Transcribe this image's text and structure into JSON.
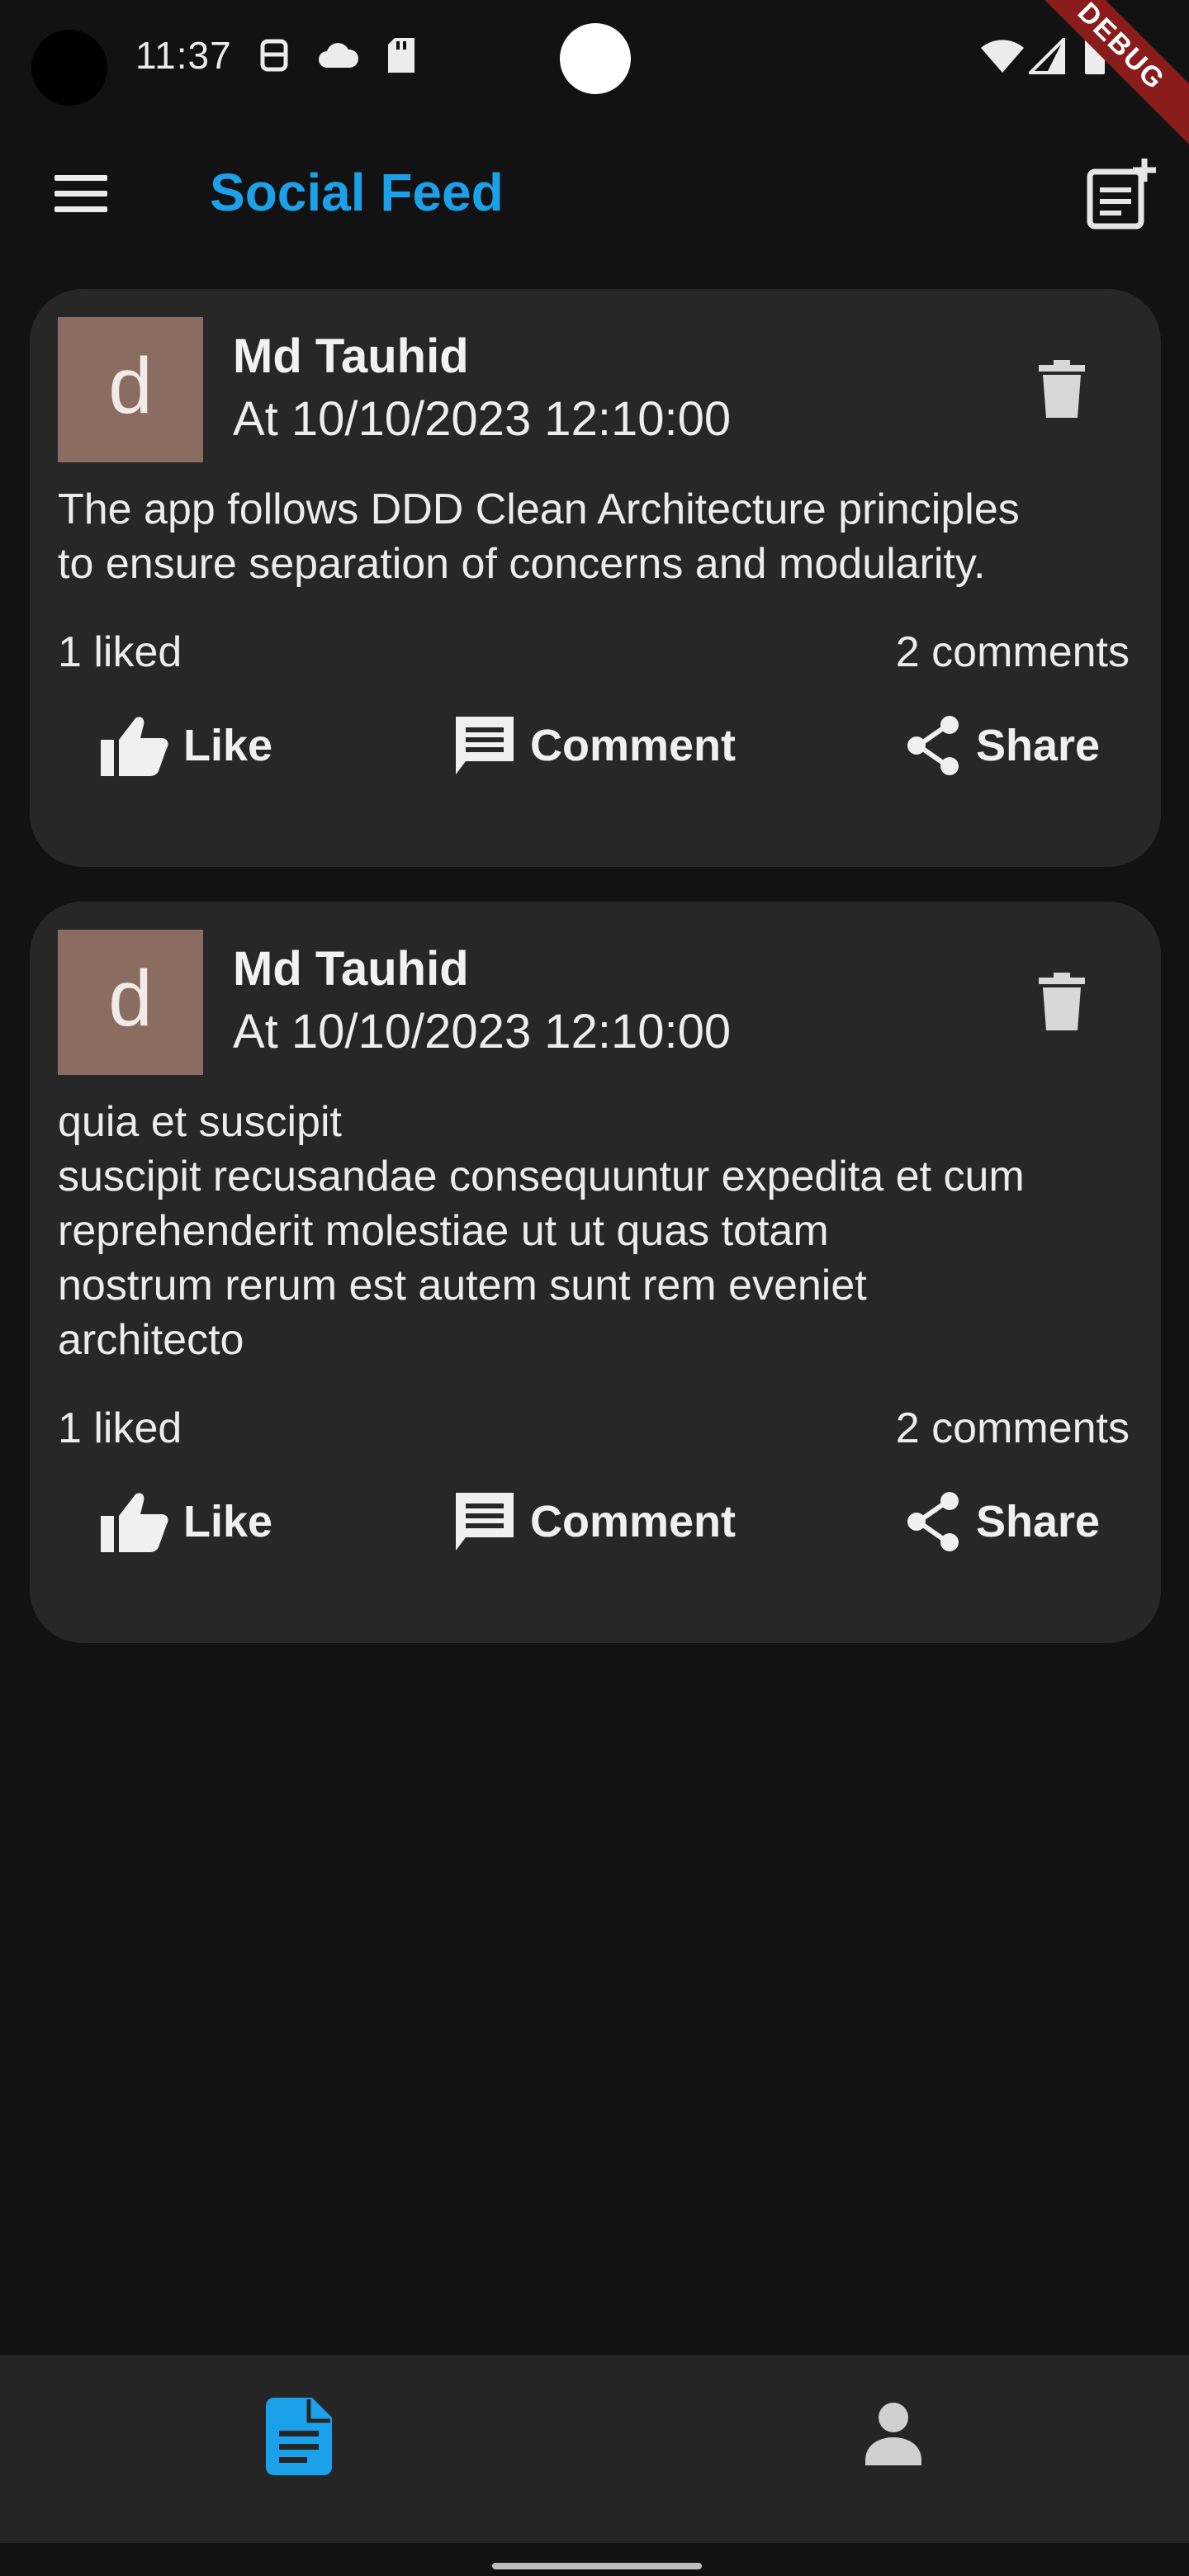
{
  "status_bar": {
    "time": "11:37",
    "debug_label": "DEBUG"
  },
  "app_bar": {
    "title": "Social Feed",
    "title_color": "#1aa1ea",
    "menu_icon": "hamburger-menu-icon",
    "action_icon": "new-post-icon"
  },
  "posts": [
    {
      "avatar_letter": "d",
      "author": "Md Tauhid",
      "timestamp": "At 10/10/2023 12:10:00",
      "body": "The app follows DDD Clean Architecture principles\nto ensure separation of concerns and modularity.",
      "liked": "1 liked",
      "comments": "2 comments"
    },
    {
      "avatar_letter": "d",
      "author": "Md Tauhid",
      "timestamp": "At 10/10/2023 12:10:00",
      "body": "quia et suscipit\nsuscipit recusandae consequuntur expedita et cum\nreprehenderit molestiae ut ut quas totam\nnostrum rerum est autem sunt rem eveniet\narchitecto",
      "liked": "1 liked",
      "comments": "2 comments"
    }
  ],
  "actions": {
    "like": "Like",
    "comment": "Comment",
    "share": "Share"
  },
  "bottom_nav": {
    "active_color": "#1aa1ea",
    "items": [
      {
        "icon": "feed-icon",
        "active": true
      },
      {
        "icon": "profile-icon",
        "active": false
      }
    ]
  }
}
